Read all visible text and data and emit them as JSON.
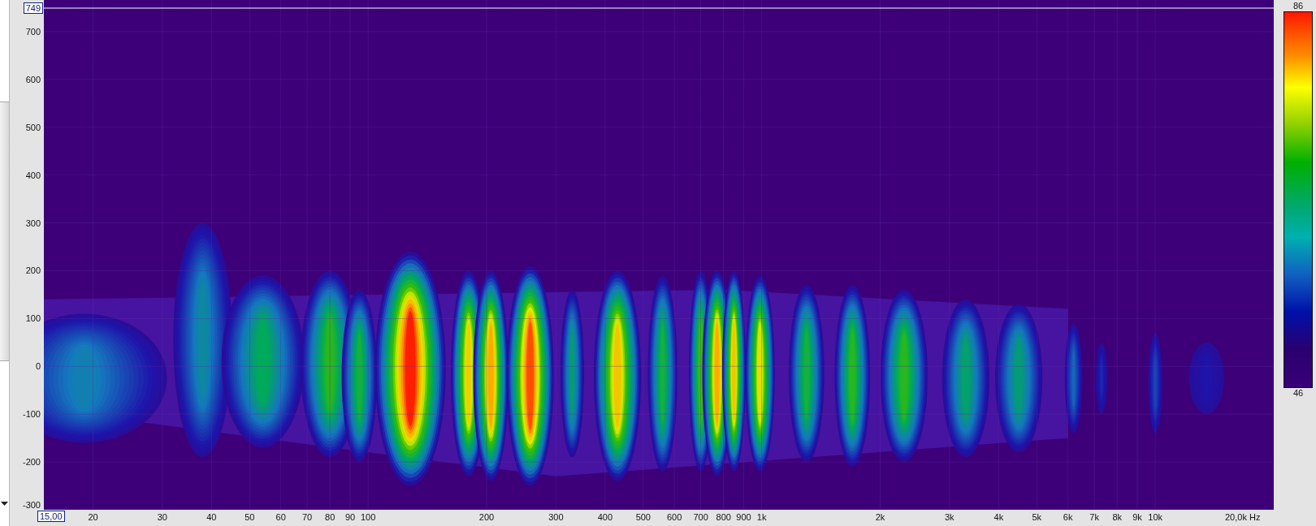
{
  "y_axis": {
    "marker": "749",
    "ticks": [
      "700",
      "600",
      "500",
      "400",
      "300",
      "200",
      "100",
      "0",
      "-100",
      "-200",
      "-300"
    ]
  },
  "x_axis": {
    "start_marker": "15,00",
    "ticks": [
      "20",
      "30",
      "40",
      "50",
      "60",
      "70",
      "80",
      "90",
      "100",
      "200",
      "300",
      "400",
      "500",
      "600",
      "700",
      "800",
      "900",
      "1k",
      "2k",
      "3k",
      "4k",
      "5k",
      "6k",
      "7k",
      "8k",
      "9k",
      "10k"
    ],
    "end_label": "20,0k Hz"
  },
  "color_scale": {
    "max": "86",
    "min": "46"
  }
}
